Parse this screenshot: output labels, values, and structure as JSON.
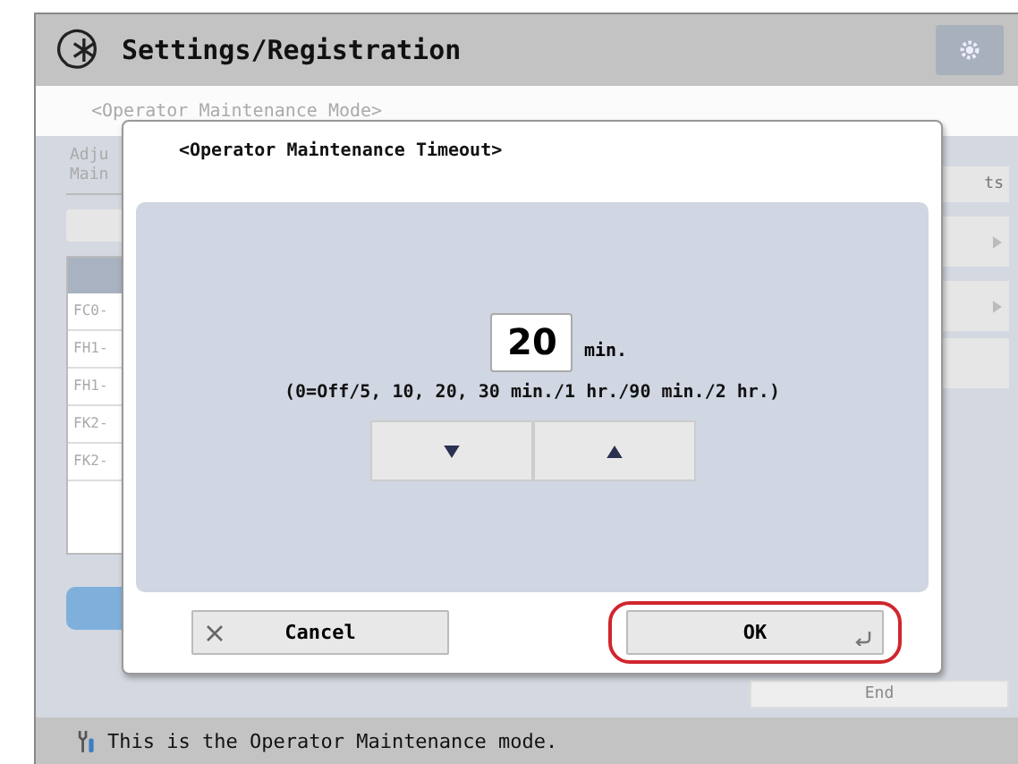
{
  "window": {
    "title": "Settings/Registration"
  },
  "breadcrumb": "<Operator Maintenance Mode>",
  "left_panel": {
    "heading_lines": [
      "Adju",
      "Main"
    ],
    "items": [
      "FC0-",
      "FH1-",
      "FH1-",
      "FK2-",
      "FK2-"
    ]
  },
  "right_panel": {
    "button_text": "ts"
  },
  "end_button": "End",
  "status_bar": "This is the Operator Maintenance mode.",
  "dialog": {
    "title": "<Operator Maintenance Timeout>",
    "value": "20",
    "unit": "min.",
    "range": "(0=Off/5, 10, 20, 30 min./1 hr./90 min./2 hr.)",
    "buttons": [
      {
        "label": "Cancel",
        "kind": "cancel",
        "highlighted": false
      },
      {
        "label": "OK",
        "kind": "ok",
        "highlighted": true
      }
    ]
  }
}
